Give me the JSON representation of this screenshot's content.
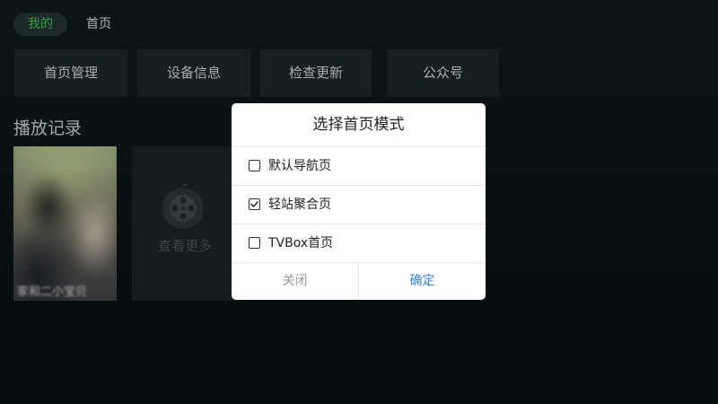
{
  "top_tabs": {
    "active": "我的",
    "other": "首页"
  },
  "actions": [
    {
      "label": "首页管理"
    },
    {
      "label": "设备信息"
    },
    {
      "label": "检查更新"
    },
    {
      "label": "公众号"
    }
  ],
  "history": {
    "title": "播放记录",
    "item_caption": "家和二小宝贝",
    "more_label": "查看更多"
  },
  "dialog": {
    "title": "选择首页模式",
    "options": [
      {
        "label": "默认导航页",
        "checked": false
      },
      {
        "label": "轻站聚合页",
        "checked": true
      },
      {
        "label": "TVBox首页",
        "checked": false
      }
    ],
    "close_label": "关闭",
    "confirm_label": "确定"
  },
  "colors": {
    "active_tab_text": "#3bbf4a",
    "confirm_text": "#2f7fe0",
    "background": "#081113"
  }
}
